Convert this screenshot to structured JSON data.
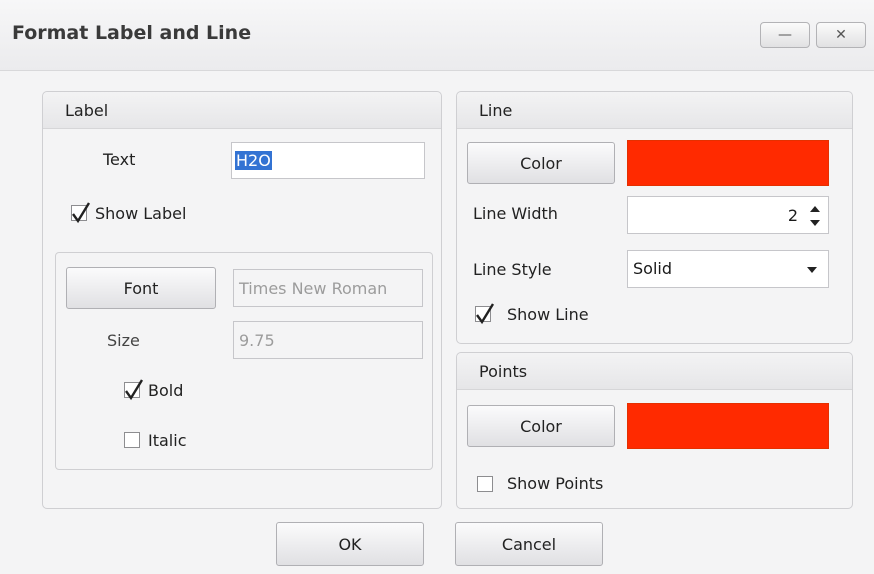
{
  "window": {
    "title": "Format Label and Line",
    "minimize_label": "—",
    "close_label": "✕"
  },
  "label_group": {
    "title": "Label",
    "text_label": "Text",
    "text_value": "H2O",
    "show_label_text": "Show Label",
    "show_label_checked": true,
    "font_button": "Font",
    "font_value": "Times New Roman",
    "size_label": "Size",
    "size_value": "9.75",
    "bold_label": "Bold",
    "bold_checked": true,
    "italic_label": "Italic",
    "italic_checked": false
  },
  "line_group": {
    "title": "Line",
    "color_button": "Color",
    "color": "#ff2a00",
    "width_label": "Line Width",
    "width_value": "2",
    "style_label": "Line Style",
    "style_value": "Solid",
    "show_line_label": "Show Line",
    "show_line_checked": true
  },
  "points_group": {
    "title": "Points",
    "color_button": "Color",
    "color": "#ff2a00",
    "show_points_label": "Show Points",
    "show_points_checked": false
  },
  "footer": {
    "ok_label": "OK",
    "cancel_label": "Cancel"
  }
}
